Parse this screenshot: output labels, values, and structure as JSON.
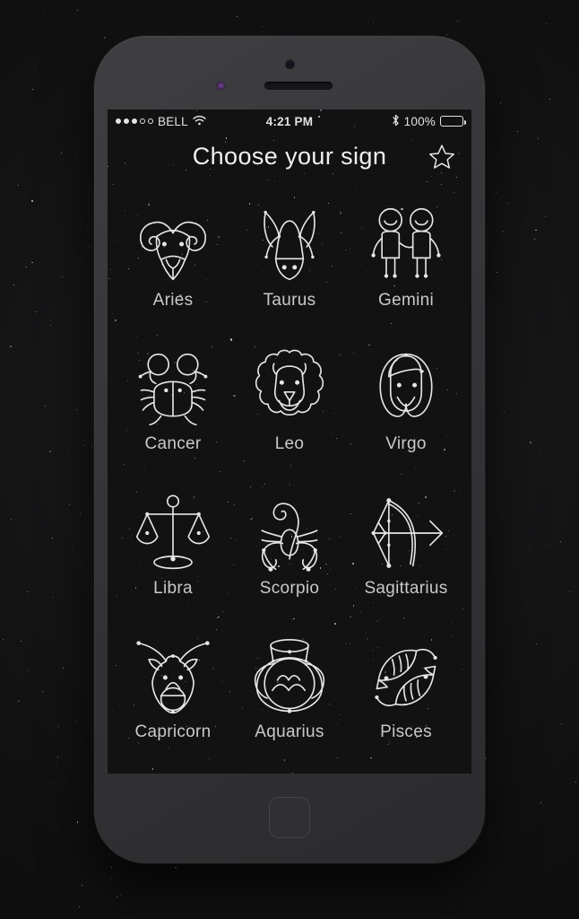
{
  "status_bar": {
    "signal_dots_filled": 3,
    "signal_dots_total": 5,
    "wifi_icon": "wifi-icon",
    "carrier": "BELL",
    "time": "4:21 PM",
    "bluetooth_icon": "bluetooth-icon",
    "battery_percent": "100%",
    "battery_icon": "battery-full-icon"
  },
  "header": {
    "title": "Choose your sign",
    "favorite_icon": "star-outline-icon"
  },
  "signs": [
    {
      "label": "Aries",
      "icon": "aries-ram-icon"
    },
    {
      "label": "Taurus",
      "icon": "taurus-bull-icon"
    },
    {
      "label": "Gemini",
      "icon": "gemini-twins-icon"
    },
    {
      "label": "Cancer",
      "icon": "cancer-crab-icon"
    },
    {
      "label": "Leo",
      "icon": "leo-lion-icon"
    },
    {
      "label": "Virgo",
      "icon": "virgo-maiden-icon"
    },
    {
      "label": "Libra",
      "icon": "libra-scales-icon"
    },
    {
      "label": "Scorpio",
      "icon": "scorpio-scorpion-icon"
    },
    {
      "label": "Sagittarius",
      "icon": "sagittarius-bow-icon"
    },
    {
      "label": "Capricorn",
      "icon": "capricorn-goat-icon"
    },
    {
      "label": "Aquarius",
      "icon": "aquarius-vessel-icon"
    },
    {
      "label": "Pisces",
      "icon": "pisces-fish-icon"
    }
  ],
  "device": {
    "camera_icon": "front-camera-icon",
    "sensor_icon": "proximity-sensor-icon",
    "speaker_icon": "earpiece-speaker-icon",
    "home_button": "home-button"
  },
  "colors": {
    "screen_bg": "#121213",
    "line_art": "#e6e6e6",
    "label_text": "#c9c9c9",
    "title_text": "#f0f0f0",
    "bezel": "#37373a",
    "page_bg": "#161617"
  }
}
